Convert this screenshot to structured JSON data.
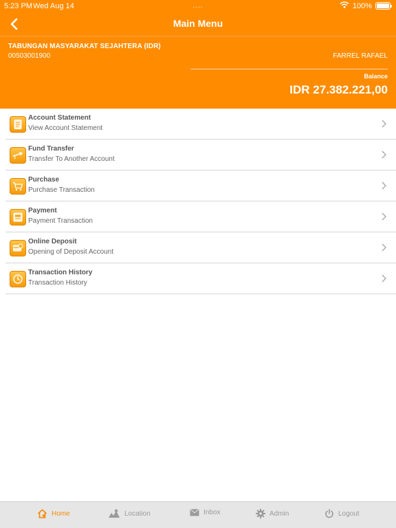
{
  "status_bar": {
    "time": "5:23 PM",
    "date": "Wed Aug 14",
    "dots": "....",
    "wifi_icon": "wifi-icon",
    "battery_percent": "100%",
    "battery_level": 1.0
  },
  "nav": {
    "title": "Main Menu",
    "back_icon": "chevron-left-icon"
  },
  "account": {
    "name": "TABUNGAN MASYARAKAT SEJAHTERA (IDR)",
    "number": "00503001900",
    "holder": "FARREL RAFAEL",
    "balance_label": "Balance",
    "balance_value": "IDR 27.382.221,00"
  },
  "menu": {
    "items": [
      {
        "title": "Account Statement",
        "subtitle": "View Account Statement",
        "icon": "document-icon"
      },
      {
        "title": "Fund Transfer",
        "subtitle": "Transfer To Another Account",
        "icon": "transfer-icon"
      },
      {
        "title": "Purchase",
        "subtitle": "Purchase Transaction",
        "icon": "cart-icon"
      },
      {
        "title": "Payment",
        "subtitle": "Payment Transaction",
        "icon": "payment-icon"
      },
      {
        "title": "Online Deposit",
        "subtitle": "Opening of Deposit Account",
        "icon": "deposit-icon"
      },
      {
        "title": "Transaction History",
        "subtitle": "Transaction History",
        "icon": "clock-icon"
      }
    ]
  },
  "tabbar": {
    "tabs": [
      {
        "label": "Home",
        "icon": "home-icon",
        "active": true
      },
      {
        "label": "Location",
        "icon": "map-icon",
        "active": false
      },
      {
        "label": "Inbox",
        "icon": "envelope-icon",
        "active": false
      },
      {
        "label": "Admin",
        "icon": "gear-icon",
        "active": false
      },
      {
        "label": "Logout",
        "icon": "power-icon",
        "active": false
      }
    ]
  },
  "colors": {
    "brand_orange": "#ff8c00",
    "icon_gradient_top": "#ffc54a",
    "icon_gradient_bottom": "#f59a0c",
    "tab_active": "#f58a07",
    "tab_inactive": "#9a9a9a",
    "tabbar_bg": "#e6e6e6"
  }
}
